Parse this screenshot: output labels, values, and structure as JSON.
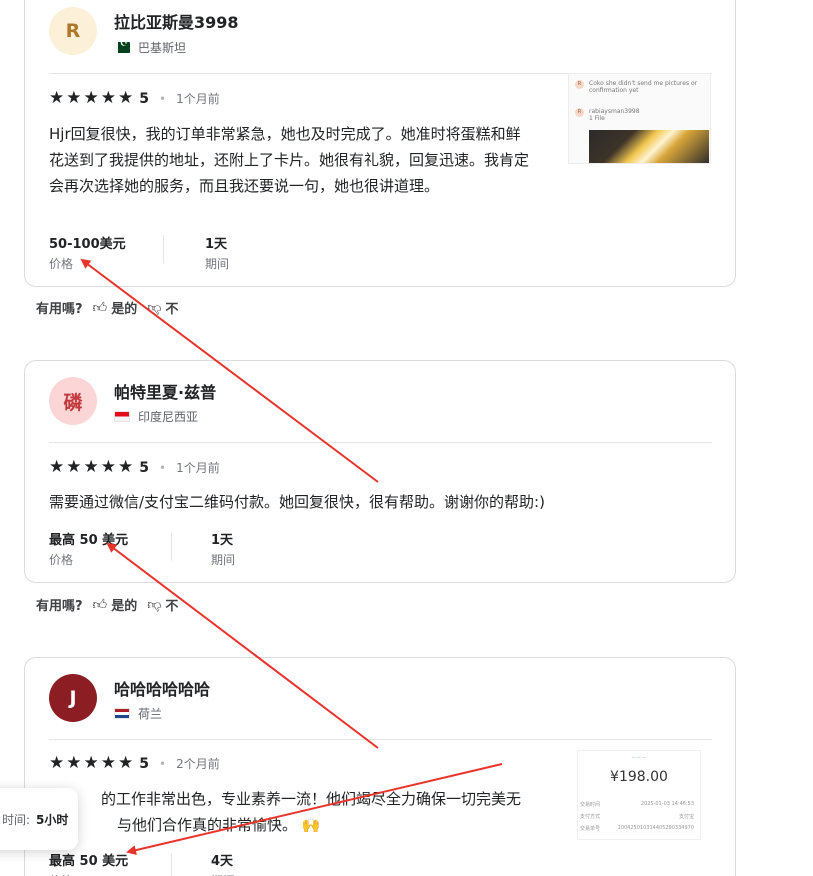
{
  "helpful": {
    "question": "有用嗎?",
    "yes": "是的",
    "no": "不"
  },
  "price_label": "价格",
  "duration_label": "期间",
  "reviews": [
    {
      "avatar_letter": "R",
      "avatar_bg": "#fdf0d8",
      "avatar_color": "#b0782a",
      "name": "拉比亚斯曼3998",
      "country": "巴基斯坦",
      "rating": "5",
      "time": "1个月前",
      "text": "Hjr回复很快，我的订单非常紧急，她也及时完成了。她准时将蛋糕和鲜花送到了我提供的地址，还附上了卡片。她很有礼貌，回复迅速。我肯定会再次选择她的服务，而且我还要说一句，她也很讲道理。",
      "price": "50-100美元",
      "duration": "1天",
      "attachment": {
        "line1": "Coko she didn't send me pictures or confirmation yet",
        "line2_name": "rabiaysman3998",
        "line2": "1 File"
      }
    },
    {
      "avatar_letter": "磷",
      "avatar_bg": "#fcd5d6",
      "avatar_color": "#c2393d",
      "name": "帕特里夏·兹普",
      "country": "印度尼西亚",
      "rating": "5",
      "time": "1个月前",
      "text": "需要通过微信/支付宝二维码付款。她回复很快，很有帮助。谢谢你的帮助:)",
      "price": "最高 50 美元",
      "duration": "1天"
    },
    {
      "avatar_letter": "J",
      "avatar_bg": "#8c1d22",
      "avatar_color": "#ffffff",
      "name": "哈哈哈哈哈哈",
      "country": "荷兰",
      "rating": "5",
      "time": "2个月前",
      "text_line1": "的工作非常出色，专业素养一流！他们竭尽全力确保一切完美无",
      "text_line2": "与他们合作真的非常愉快。",
      "emoji": "🙌",
      "price": "最高 50 美元",
      "duration": "4天",
      "attachment": {
        "amount": "¥198.00",
        "rows": [
          {
            "k": "交易时间",
            "v": "2025-01-03 14:46:53"
          },
          {
            "k": "支付方式",
            "v": "支付宝"
          },
          {
            "k": "交易单号",
            "v": "100425010314405290334970"
          }
        ]
      }
    }
  ],
  "toast": {
    "label": "时间:",
    "value": "5小时"
  },
  "colors": {
    "arrow": "#e8342a",
    "star": "#222325"
  }
}
